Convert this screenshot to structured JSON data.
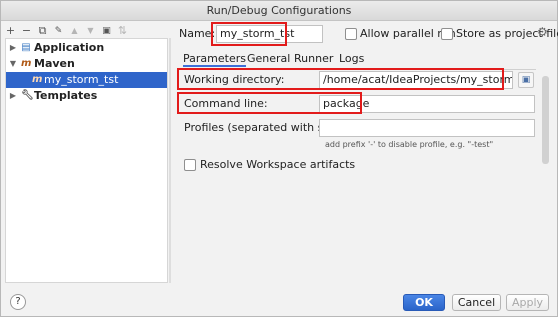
{
  "window": {
    "title": "Run/Debug Configurations"
  },
  "toolbar": {
    "add": "+",
    "remove": "−",
    "copy": "⧉",
    "edit_defaults": "🔧",
    "move_up": "▲",
    "move_down": "▼",
    "folder": "📁",
    "sort": "⇅"
  },
  "tree": {
    "items": [
      {
        "label": "Application",
        "icon": "application-icon",
        "arrow": "▶"
      },
      {
        "label": "Maven",
        "icon": "maven-icon",
        "arrow": "▼",
        "icon_glyph": "m"
      },
      {
        "label": "my_storm_tst",
        "icon": "maven-config-icon",
        "icon_glyph": "m",
        "selected": true
      },
      {
        "label": "Templates",
        "icon": "wrench-icon",
        "arrow": "▶"
      }
    ]
  },
  "header": {
    "name_label": "Name:",
    "name_value": "my_storm_tst",
    "allow_parallel_label": "Allow parallel run",
    "store_as_project_label": "Store as project file"
  },
  "tabs": [
    {
      "label": "Parameters",
      "active": true
    },
    {
      "label": "General"
    },
    {
      "label": "Runner"
    },
    {
      "label": "Logs"
    }
  ],
  "parameters": {
    "working_dir_label": "Working directory:",
    "working_dir_value": "/home/acat/IdeaProjects/my_storm_test",
    "command_line_label": "Command line:",
    "command_line_value": "package",
    "profiles_label": "Profiles (separated with space):",
    "profiles_value": "",
    "profiles_hint": "add prefix '-' to disable profile, e.g. \"-test\"",
    "resolve_workspace_label": "Resolve Workspace artifacts"
  },
  "buttons": {
    "help": "?",
    "ok": "OK",
    "cancel": "Cancel",
    "apply": "Apply"
  },
  "colors": {
    "selection": "#2f65ca",
    "highlight_box": "#e21b1b",
    "primary_button": "#2a64c9"
  }
}
